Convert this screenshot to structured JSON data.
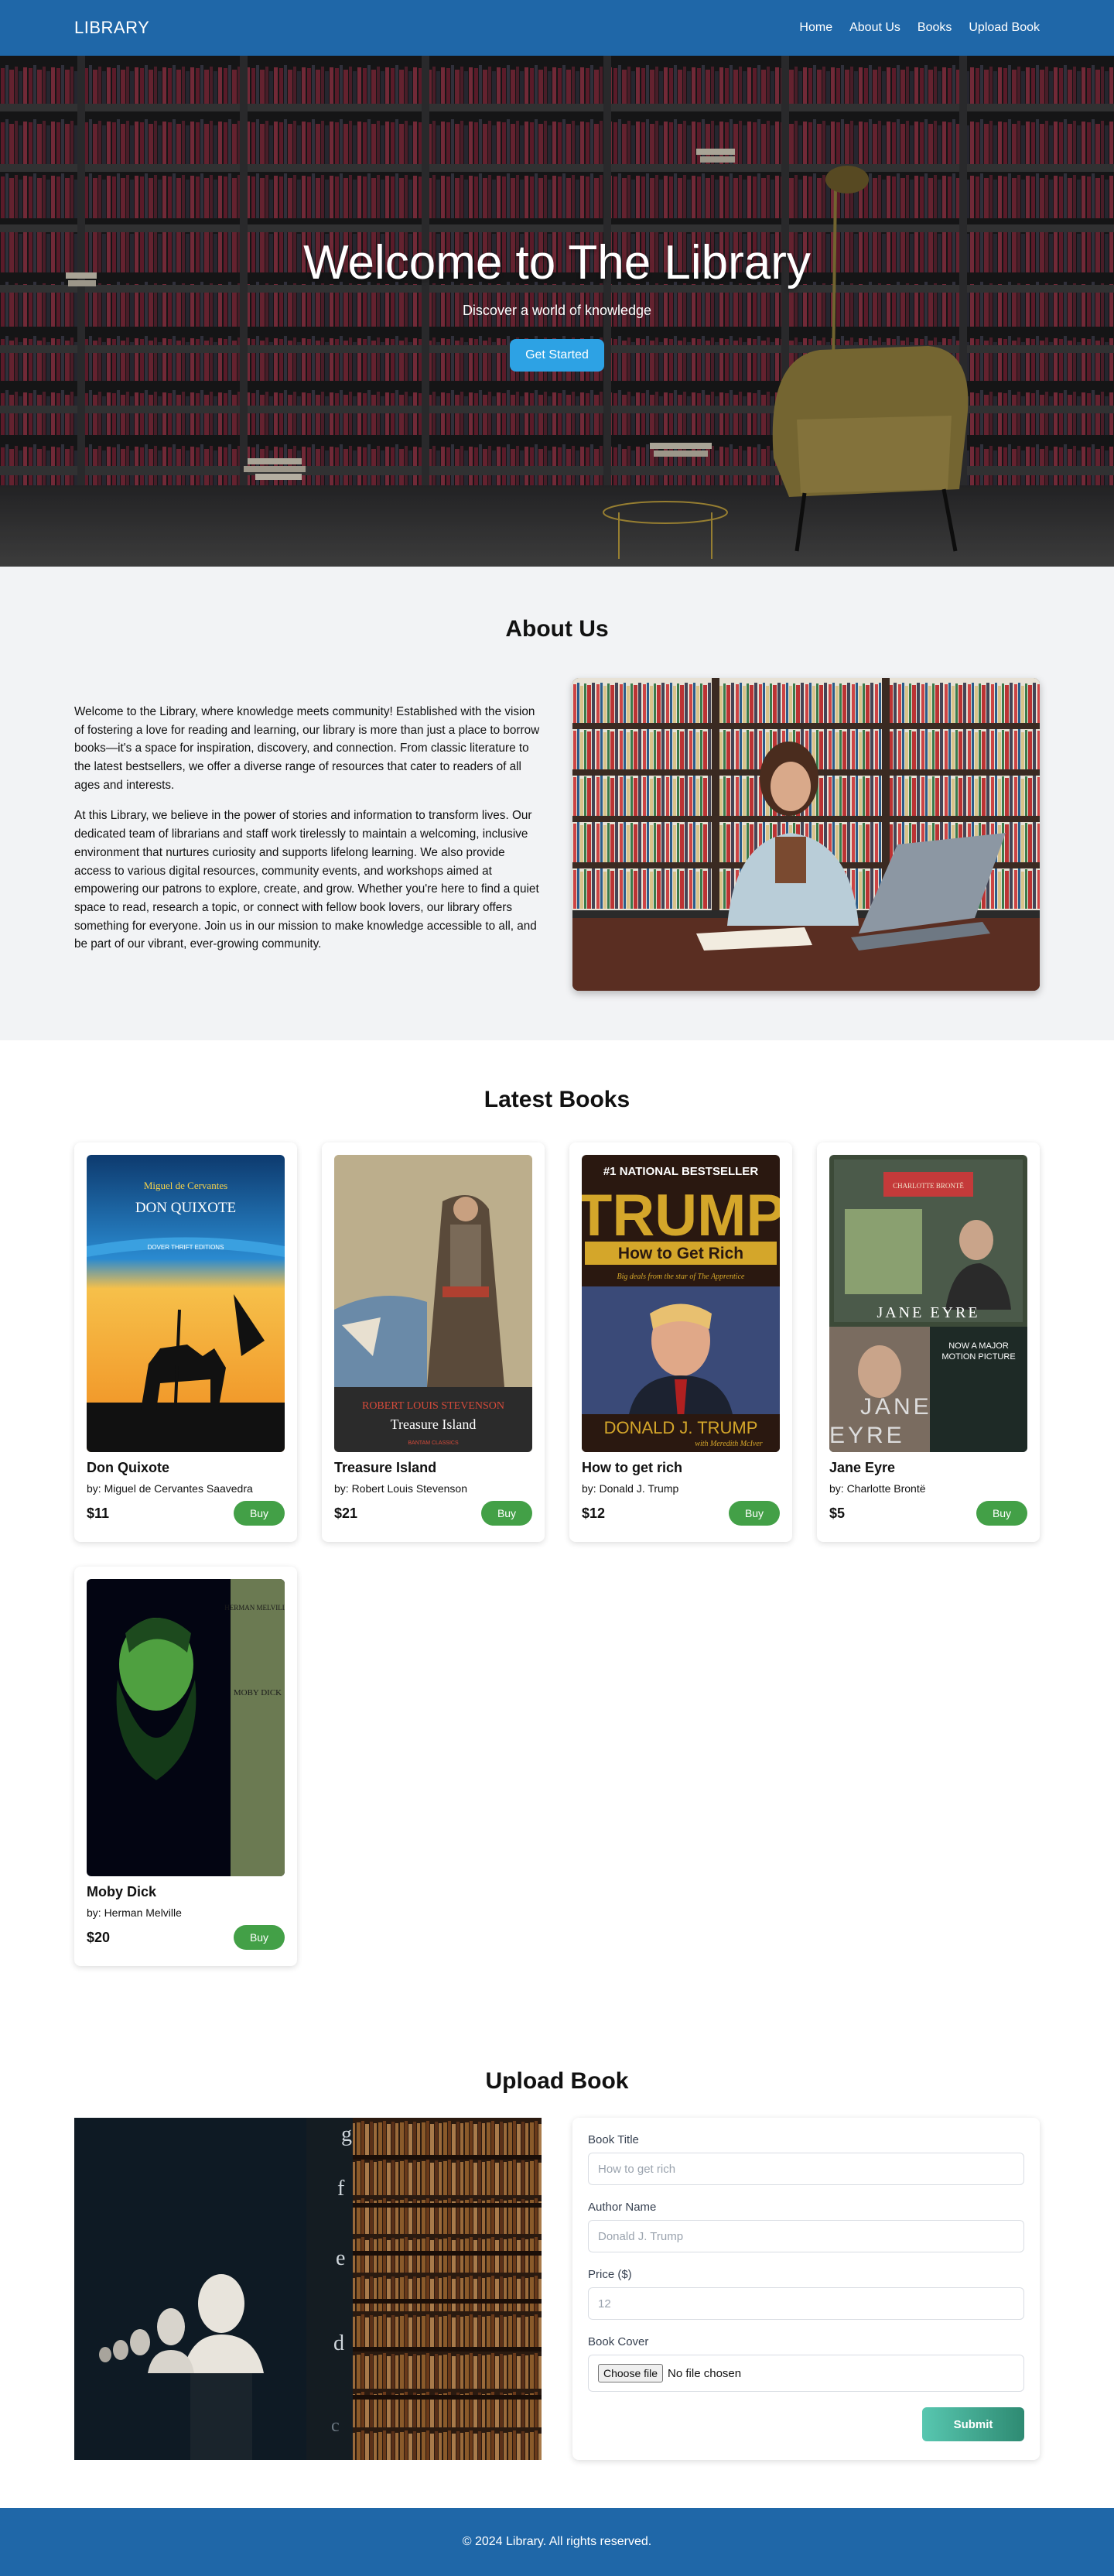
{
  "nav": {
    "brand": "LIBRARY",
    "links": [
      "Home",
      "About Us",
      "Books",
      "Upload Book"
    ]
  },
  "hero": {
    "title": "Welcome to The Library",
    "subtitle": "Discover a world of knowledge",
    "cta": "Get Started"
  },
  "about": {
    "title": "About Us",
    "paragraphs": [
      "Welcome to the Library, where knowledge meets community! Established with the vision of fostering a love for reading and learning, our library is more than just a place to borrow books—it's a space for inspiration, discovery, and connection. From classic literature to the latest bestsellers, we offer a diverse range of resources that cater to readers of all ages and interests.",
      "At this Library, we believe in the power of stories and information to transform lives. Our dedicated team of librarians and staff work tirelessly to maintain a welcoming, inclusive environment that nurtures curiosity and supports lifelong learning. We also provide access to various digital resources, community events, and workshops aimed at empowering our patrons to explore, create, and grow. Whether you're here to find a quiet space to read, research a topic, or connect with fellow book lovers, our library offers something for everyone. Join us in our mission to make knowledge accessible to all, and be part of our vibrant, ever-growing community."
    ]
  },
  "books": {
    "title": "Latest Books",
    "buy_label": "Buy",
    "items": [
      {
        "title": "Don Quixote",
        "author": "by: Miguel de Cervantes Saavedra",
        "price": "$11",
        "cover": {
          "line1": "Miguel de Cervantes",
          "line2": "DON QUIXOTE",
          "line3": "DOVER THRIFT EDITIONS"
        }
      },
      {
        "title": "Treasure Island",
        "author": "by: Robert Louis Stevenson",
        "price": "$21",
        "cover": {
          "line1": "ROBERT LOUIS STEVENSON",
          "line2": "Treasure Island",
          "line3": "BANTAM CLASSICS"
        }
      },
      {
        "title": "How to get rich",
        "author": "by: Donald J. Trump",
        "price": "$12",
        "cover": {
          "line1": "#1 NATIONAL BESTSELLER",
          "line2": "TRUMP",
          "line3": "How to Get Rich",
          "line4": "Big deals from the star of The Apprentice",
          "line5": "DONALD J. TRUMP",
          "line6": "with Meredith McIver"
        }
      },
      {
        "title": "Jane Eyre",
        "author": "by: Charlotte Brontë",
        "price": "$5",
        "cover": {
          "line1": "CHARLOTTE BRONTË",
          "line2": "JANE EYRE",
          "line3": "NOW A MAJOR MOTION PICTURE",
          "line4": "JANE",
          "line5": "EYRE"
        }
      },
      {
        "title": "Moby Dick",
        "author": "by: Herman Melville",
        "price": "$20",
        "cover": {
          "line1": "HERMAN MELVILLE",
          "line2": "MOBY DICK"
        }
      }
    ]
  },
  "upload": {
    "title": "Upload Book",
    "fields": {
      "title_label": "Book Title",
      "title_placeholder": "How to get rich",
      "author_label": "Author Name",
      "author_placeholder": "Donald J. Trump",
      "price_label": "Price ($)",
      "price_placeholder": "12",
      "cover_label": "Book Cover",
      "choose_file": "Choose file",
      "no_file": "No file chosen"
    },
    "submit": "Submit"
  },
  "footer": {
    "text": "© 2024 Library. All rights reserved."
  },
  "colors": {
    "primary": "#1f67a8",
    "hero_button": "#2da2e4",
    "buy": "#43a047",
    "submit_start": "#58c7b0",
    "submit_end": "#2e8a72"
  }
}
